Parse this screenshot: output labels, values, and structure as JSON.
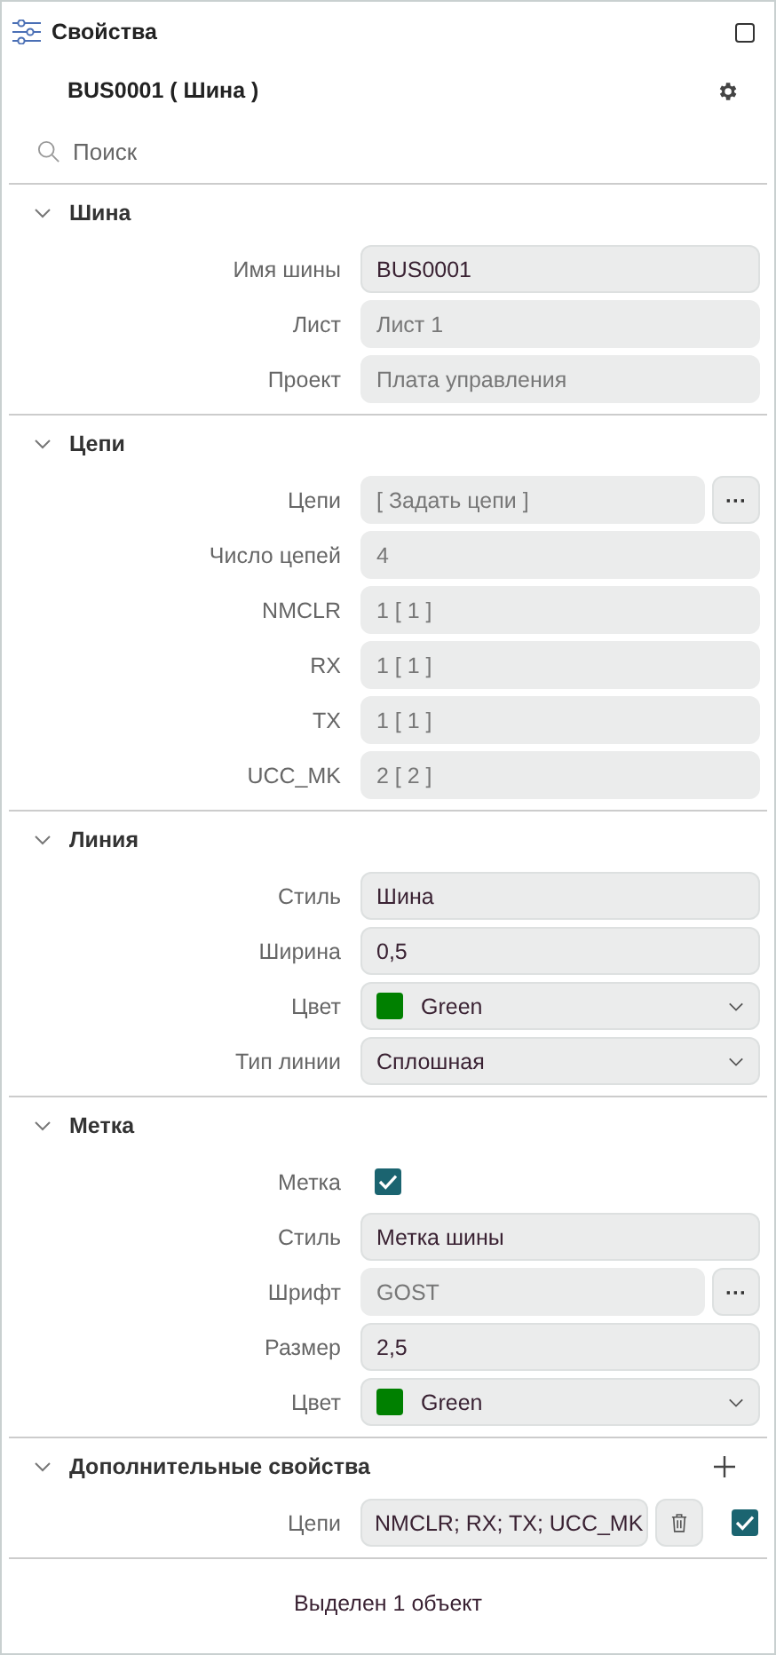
{
  "panel": {
    "title": "Свойства",
    "object": "BUS0001 ( Шина )"
  },
  "search": {
    "placeholder": "Поиск"
  },
  "sections": [
    {
      "title": "Шина",
      "expanded": true,
      "can_add": false,
      "rows": [
        {
          "kind": "field",
          "label": "Имя шины",
          "value": "BUS0001",
          "editable": true
        },
        {
          "kind": "field",
          "label": "Лист",
          "value": "Лист 1",
          "editable": false
        },
        {
          "kind": "field",
          "label": "Проект",
          "value": "Плата управления",
          "editable": false
        }
      ]
    },
    {
      "title": "Цепи",
      "expanded": true,
      "can_add": false,
      "rows": [
        {
          "kind": "picker",
          "label": "Цепи",
          "value": "[ Задать цепи ]",
          "editable": false,
          "button": "···"
        },
        {
          "kind": "field",
          "label": "Число цепей",
          "value": "4",
          "editable": false
        },
        {
          "kind": "field",
          "label": "NMCLR",
          "value": "1 [ 1 ]",
          "editable": false
        },
        {
          "kind": "field",
          "label": "RX",
          "value": "1 [ 1 ]",
          "editable": false
        },
        {
          "kind": "field",
          "label": "TX",
          "value": "1 [ 1 ]",
          "editable": false
        },
        {
          "kind": "field",
          "label": "UCC_MK",
          "value": "2 [ 2 ]",
          "editable": false
        }
      ]
    },
    {
      "title": "Линия",
      "expanded": true,
      "can_add": false,
      "rows": [
        {
          "kind": "field",
          "label": "Стиль",
          "value": "Шина",
          "editable": true
        },
        {
          "kind": "field",
          "label": "Ширина",
          "value": "0,5",
          "editable": true
        },
        {
          "kind": "select",
          "label": "Цвет",
          "value": "Green",
          "color": "#008000"
        },
        {
          "kind": "select",
          "label": "Тип линии",
          "value": "Сплошная"
        }
      ]
    },
    {
      "title": "Метка",
      "expanded": true,
      "can_add": false,
      "rows": [
        {
          "kind": "checkbox",
          "label": "Метка",
          "checked": true
        },
        {
          "kind": "field",
          "label": "Стиль",
          "value": "Метка шины",
          "editable": true
        },
        {
          "kind": "picker",
          "label": "Шрифт",
          "value": "GOST",
          "editable": false,
          "button": "···"
        },
        {
          "kind": "field",
          "label": "Размер",
          "value": "2,5",
          "editable": true
        },
        {
          "kind": "select",
          "label": "Цвет",
          "value": "Green",
          "color": "#008000"
        }
      ]
    },
    {
      "title": "Дополнительные свойства",
      "expanded": true,
      "can_add": true,
      "rows": [
        {
          "kind": "extra",
          "label": "Цепи",
          "value": "NMCLR; RX; TX; UCC_MK",
          "editable": true,
          "checked": true
        }
      ]
    }
  ],
  "status": "Выделен 1 объект"
}
